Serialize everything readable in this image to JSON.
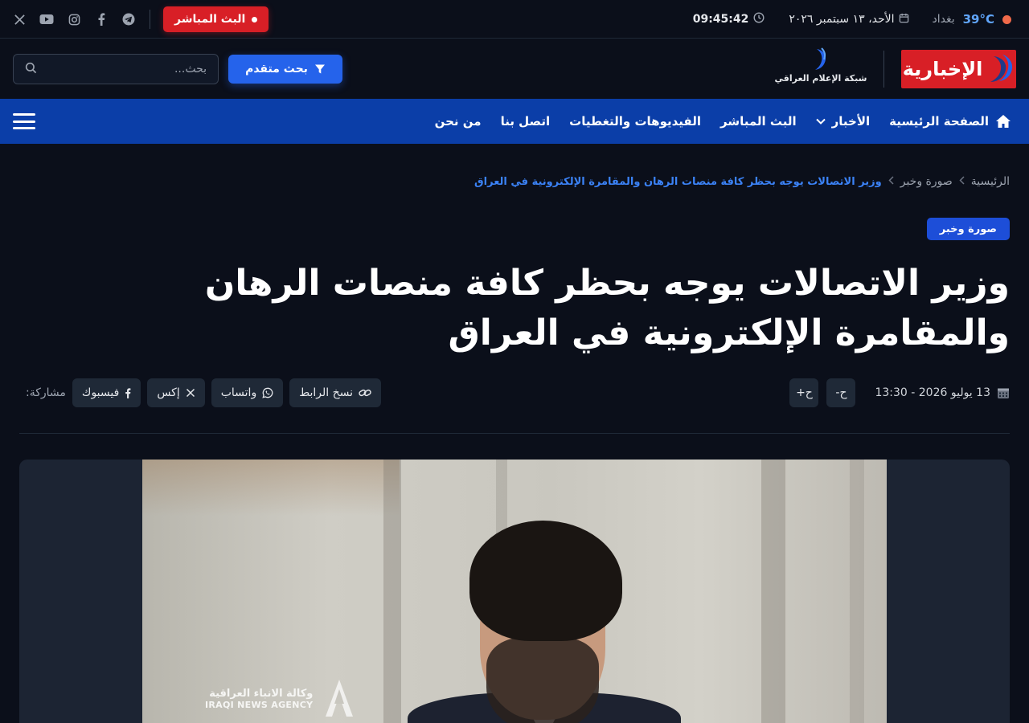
{
  "topbar": {
    "temperature": "39°C",
    "city": "بغداد",
    "date": "الأحد، ١٣ سبتمبر ٢٠٢٦",
    "time": "09:45:42",
    "live_label": "البث المباشر",
    "social_icons": [
      "x-icon",
      "youtube-icon",
      "instagram-icon",
      "facebook-icon",
      "telegram-icon"
    ]
  },
  "header": {
    "logo_text": "الإخبارية",
    "network_text": "شبكة الإعلام العراقي",
    "advanced_search_label": "بحث متقدم",
    "search_placeholder": "بحث..."
  },
  "nav": {
    "items": [
      {
        "label": "الصفحة الرئيسية"
      },
      {
        "label": "الأخبار"
      },
      {
        "label": "البث المباشر"
      },
      {
        "label": "الفيديوهات والتغطيات"
      },
      {
        "label": "اتصل بنا"
      },
      {
        "label": "من نحن"
      }
    ]
  },
  "breadcrumb": {
    "home": "الرئيسية",
    "category": "صورة وخبر",
    "current": "وزير الاتصالات يوجه بحظر كافة منصات الرهان والمقامرة الإلكترونية في العراق"
  },
  "article": {
    "category": "صورة وخبر",
    "title": "وزير الاتصالات يوجه بحظر كافة منصات الرهان والمقامرة الإلكترونية في العراق",
    "datetime": "13 يوليو 2026 - 13:30",
    "font_decrease": "ح-",
    "font_increase": "ح+",
    "share_label": "مشاركة:",
    "share_buttons": {
      "facebook": "فيسبوك",
      "x": "إكس",
      "whatsapp": "واتساب",
      "copy_link": "نسخ الرابط"
    },
    "image_watermark_ar": "وكالة الانباء العراقية",
    "image_watermark_en": "IRAQI NEWS AGENCY"
  },
  "colors": {
    "background": "#0b0f1a",
    "brand_red": "#d81f26",
    "nav_blue": "#0b3ea8",
    "accent_blue": "#2563eb",
    "temperature": "#60a5fa"
  }
}
